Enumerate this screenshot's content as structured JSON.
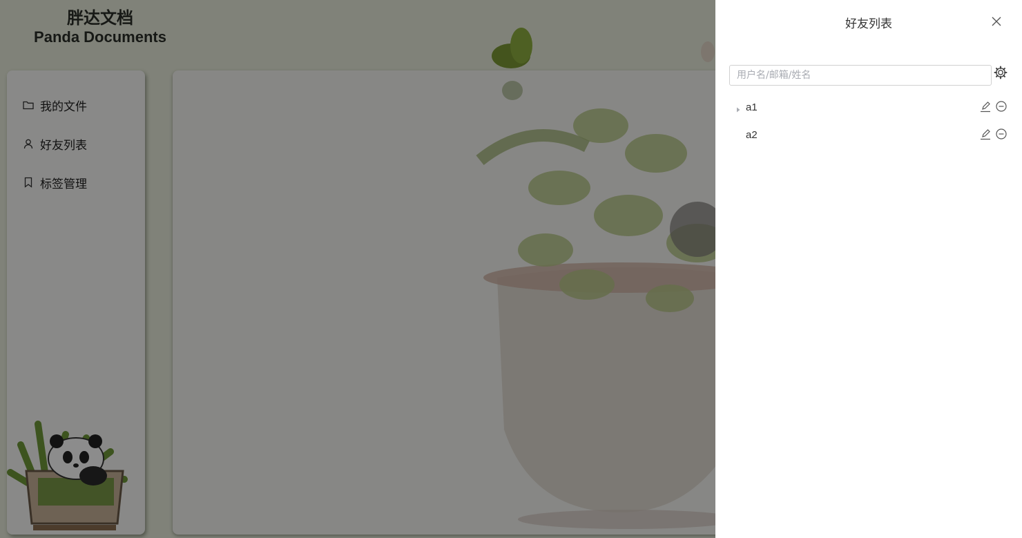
{
  "brand": {
    "title_cn": "胖达文档",
    "title_en": "Panda Documents"
  },
  "sidebar": {
    "items": [
      {
        "label": "我的文件",
        "icon": "folder-icon"
      },
      {
        "label": "好友列表",
        "icon": "user-icon"
      },
      {
        "label": "标签管理",
        "icon": "bookmark-icon"
      }
    ]
  },
  "drawer": {
    "title": "好友列表",
    "search": {
      "placeholder": "用户名/邮箱/姓名",
      "value": ""
    },
    "friends": [
      {
        "name": "a1",
        "expandable": true
      },
      {
        "name": "a2",
        "expandable": false
      }
    ]
  },
  "colors": {
    "background": "#e9eddc",
    "overlay": "rgba(0,0,0,0.45)",
    "drawer": "#ffffff"
  }
}
